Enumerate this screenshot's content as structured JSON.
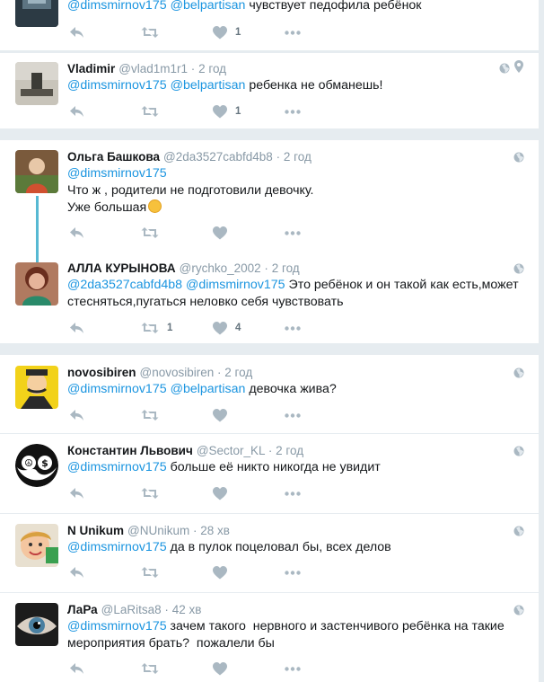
{
  "tweets": [
    {
      "name": "",
      "handle": "",
      "time": "",
      "mentions": [
        "@dimsmirnov175",
        "@belpartisan"
      ],
      "text": "чувствует педофила ребёнок",
      "likes": "1",
      "retweets": ""
    },
    {
      "name": "Vladimir",
      "handle": "@vlad1m1r1",
      "time": "2 год",
      "mentions": [
        "@dimsmirnov175",
        "@belpartisan"
      ],
      "text": "ребенка не обманешь!",
      "likes": "1",
      "retweets": ""
    },
    {
      "name": "Ольга Башкова",
      "handle": "@2da3527cabfd4b8",
      "time": "2 год",
      "mentions": [
        "@dimsmirnov175"
      ],
      "text_line1": "Что ж , родители не подготовили девочку.",
      "text_line2": "Уже большая",
      "likes": "",
      "retweets": ""
    },
    {
      "name": "АЛЛА КУРЫНОВА",
      "handle": "@rychko_2002",
      "time": "2 год",
      "mentions": [
        "@2da3527cabfd4b8",
        "@dimsmirnov175"
      ],
      "text_line1": "Это ребёнок и он такой как есть,может",
      "text_line2": "стесняться,пугаться неловко себя чувствовать",
      "likes": "4",
      "retweets": "1"
    },
    {
      "name": "novosibiren",
      "handle": "@novosibiren",
      "time": "2 год",
      "mentions": [
        "@dimsmirnov175",
        "@belpartisan"
      ],
      "text": "девочка жива?",
      "likes": "",
      "retweets": ""
    },
    {
      "name": "Константин Львович",
      "handle": "@Sector_KL",
      "time": "2 год",
      "mentions": [
        "@dimsmirnov175"
      ],
      "text": "больше её никто никогда не увидит",
      "likes": "",
      "retweets": ""
    },
    {
      "name": "N Unikum",
      "handle": "@NUnikum",
      "time": "28 хв",
      "mentions": [
        "@dimsmirnov175"
      ],
      "text": "да в пулок поцеловал бы, всех делов",
      "likes": "",
      "retweets": ""
    },
    {
      "name": "ЛаРа",
      "handle": "@LaRitsa8",
      "time": "42 хв",
      "mentions": [
        "@dimsmirnov175"
      ],
      "text_line1": " зачем такого  нервного и застенчивого ребёнка на такие",
      "text_line2": "мероприятия брать?  пожалели бы",
      "likes": "",
      "retweets": ""
    }
  ],
  "separator": "·",
  "icons": {
    "reply": "reply-icon",
    "retweet": "retweet-icon",
    "like": "heart-icon",
    "more": "more-icon",
    "globe": "globe-icon",
    "location": "location-pin-icon"
  },
  "colors": {
    "link": "#1b95e0",
    "muted": "#8899a6",
    "action": "#aab8c2",
    "thread": "#57b9d3",
    "background": "#e6ecf0"
  }
}
